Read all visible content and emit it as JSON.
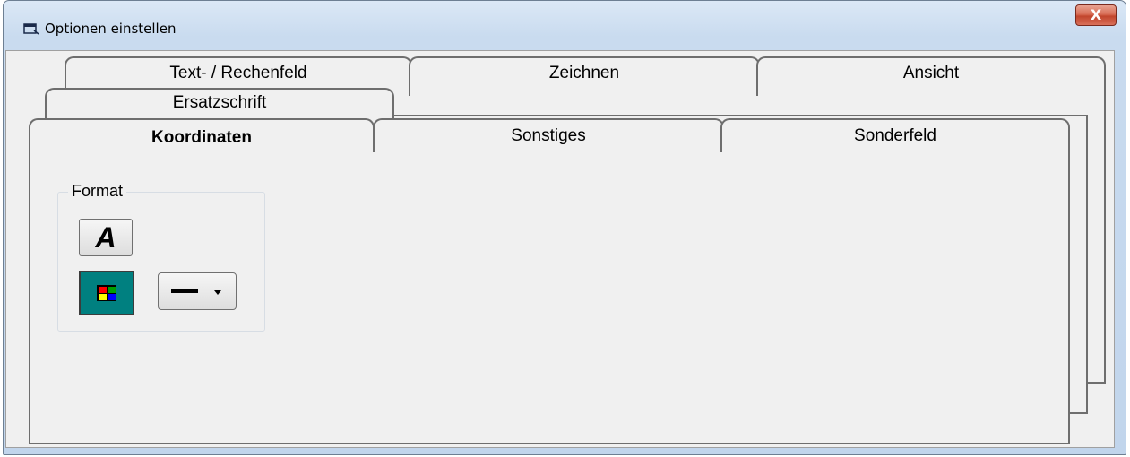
{
  "window": {
    "title": "Optionen einstellen",
    "close_label": "X"
  },
  "tabs": {
    "row_back": [
      "Text- / Rechenfeld",
      "Zeichnen",
      "Ansicht"
    ],
    "row_middle": [
      "Ersatzschrift"
    ],
    "row_front": [
      "Koordinaten",
      "Sonstiges",
      "Sonderfeld"
    ],
    "active": "Koordinaten"
  },
  "format_group": {
    "label": "Format",
    "font_button_glyph": "A",
    "color_button_icon": "color-palette-icon",
    "line_style_icon": "line-style-icon"
  },
  "colors": {
    "teal": "#008080",
    "palette": [
      "#ff0000",
      "#00a000",
      "#ffff00",
      "#0000ff"
    ]
  }
}
